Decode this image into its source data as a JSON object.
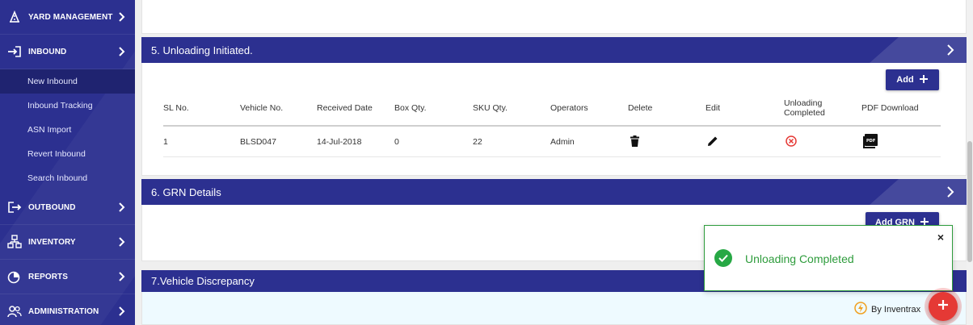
{
  "sidebar": {
    "sections": [
      {
        "label": "YARD MANAGEMENT",
        "icon": "road-icon"
      },
      {
        "label": "INBOUND",
        "icon": "sign-in-icon"
      },
      {
        "label": "OUTBOUND",
        "icon": "sign-out-icon"
      },
      {
        "label": "INVENTORY",
        "icon": "inventory-icon"
      },
      {
        "label": "REPORTS",
        "icon": "pie-chart-icon"
      },
      {
        "label": "ADMINISTRATION",
        "icon": "users-icon"
      }
    ],
    "inbound_items": [
      {
        "label": "New Inbound"
      },
      {
        "label": "Inbound Tracking"
      },
      {
        "label": "ASN Import"
      },
      {
        "label": "Revert Inbound"
      },
      {
        "label": "Search Inbound"
      }
    ],
    "colors": {
      "background": "#2c3090",
      "active": "#1f2370"
    }
  },
  "unloading": {
    "title": "5. Unloading Initiated.",
    "add_label": "Add",
    "columns": [
      "SL No.",
      "Vehicle No.",
      "Received Date",
      "Box Qty.",
      "SKU Qty.",
      "Operators",
      "Delete",
      "Edit",
      "Unloading Completed",
      "PDF Download"
    ],
    "rows": [
      {
        "sl": "1",
        "vehicle": "BLSD047",
        "date": "14-Jul-2018",
        "box": "0",
        "sku": "22",
        "operator": "Admin"
      }
    ]
  },
  "grn": {
    "title": "6. GRN Details",
    "add_label": "Add GRN"
  },
  "discrepancy": {
    "title": "7.Vehicle Discrepancy"
  },
  "toast": {
    "message": "Unloading Completed",
    "close": "×",
    "color": "#2e9c3c"
  },
  "footer": {
    "brand": "By Inventrax"
  },
  "accent": "#2c3090",
  "fab_color": "#e53935"
}
